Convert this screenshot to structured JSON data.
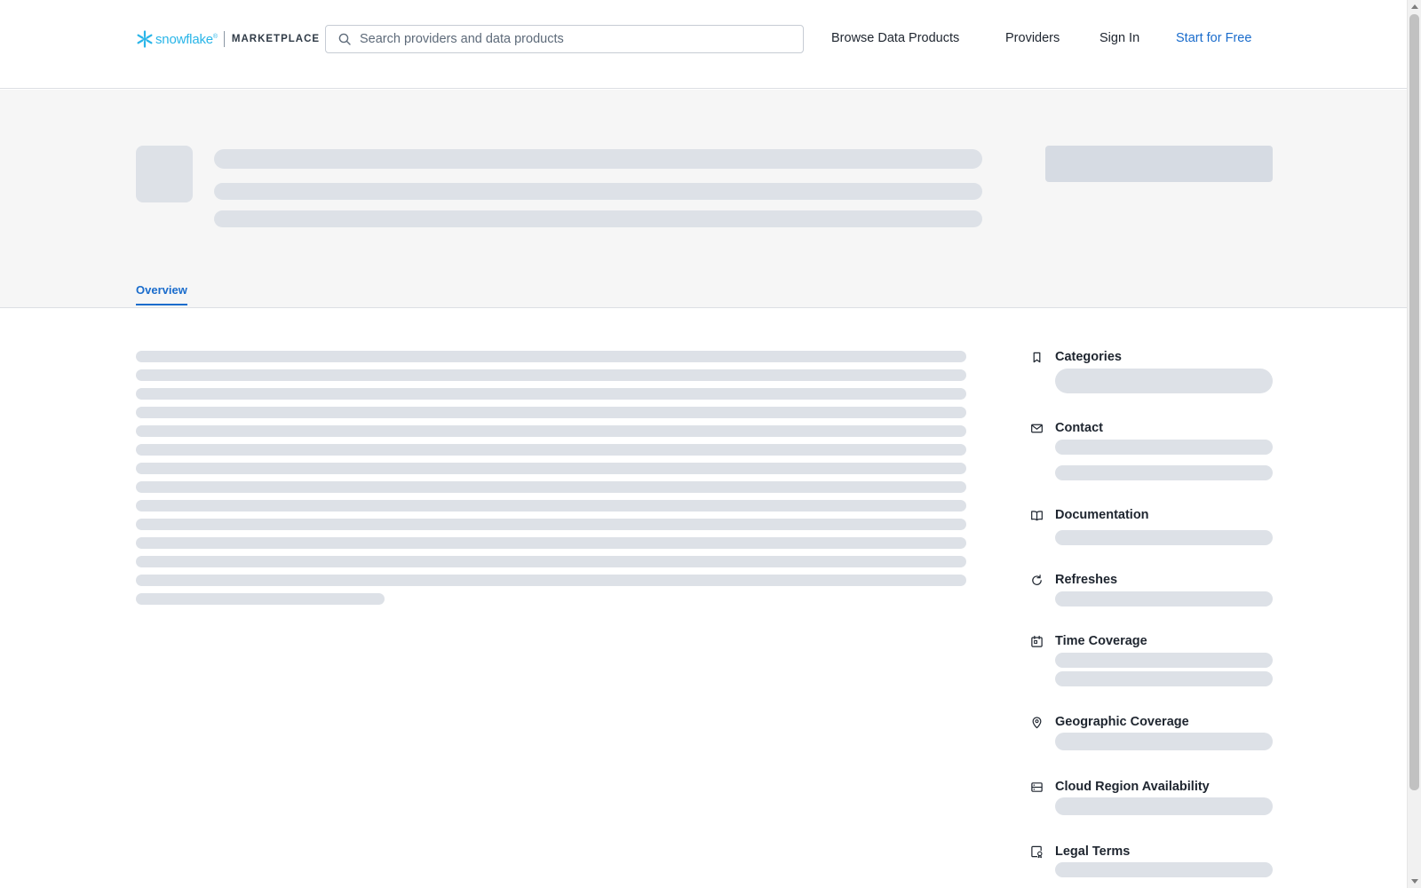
{
  "header": {
    "brand": "snowflake",
    "brand_mark": "®",
    "section": "MARKETPLACE",
    "search": {
      "placeholder": "Search providers and data products",
      "value": ""
    },
    "nav": {
      "browse": "Browse Data Products",
      "providers": "Providers",
      "sign_in": "Sign In",
      "start_free": "Start for Free"
    }
  },
  "tabs": {
    "overview": "Overview"
  },
  "sidebar": {
    "categories": "Categories",
    "contact": "Contact",
    "documentation": "Documentation",
    "refreshes": "Refreshes",
    "time_coverage": "Time Coverage",
    "geographic_coverage": "Geographic Coverage",
    "cloud_region": "Cloud Region Availability",
    "legal_terms": "Legal Terms"
  },
  "colors": {
    "accent": "#1a6ccc",
    "brand": "#29b5e8",
    "skeleton": "#dde1e7",
    "hero_background": "#f6f6f6"
  },
  "icons": [
    "snowflake-logo-icon",
    "search-icon",
    "bookmark-icon",
    "mail-icon",
    "book-icon",
    "refresh-icon",
    "calendar-icon",
    "map-pin-icon",
    "server-icon",
    "certificate-icon"
  ]
}
